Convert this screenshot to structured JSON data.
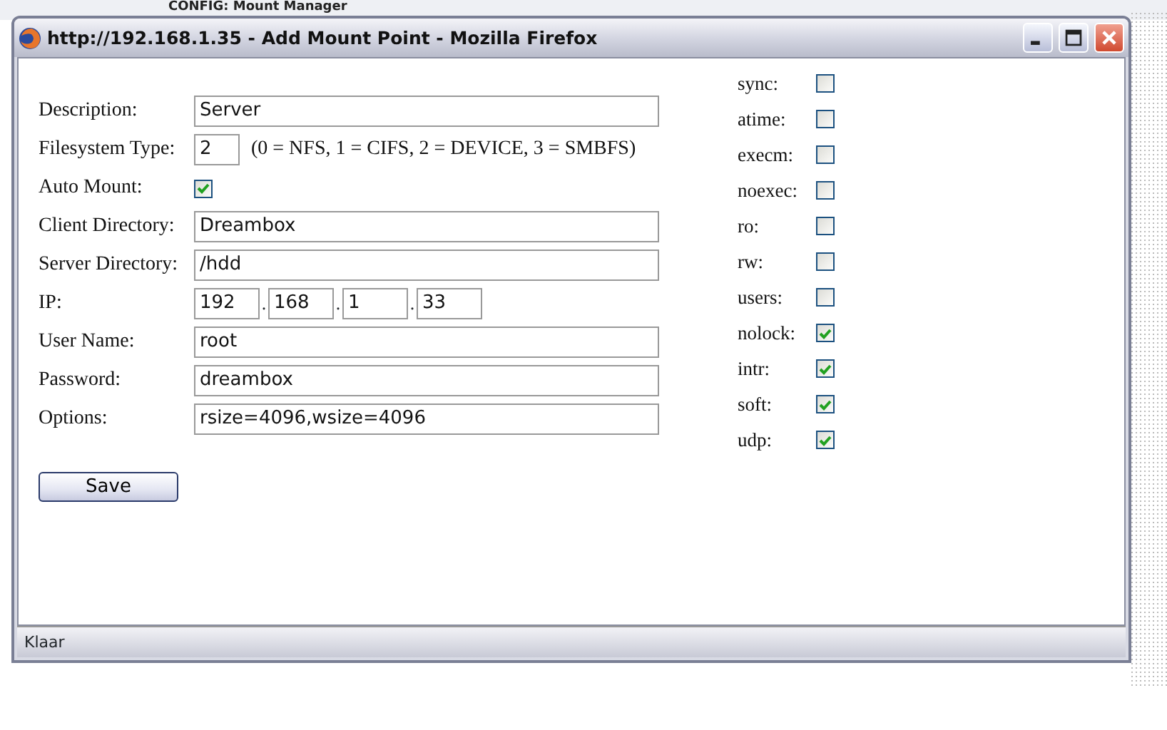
{
  "background_title": "CONFIG: Mount Manager",
  "window": {
    "title": "http://192.168.1.35 - Add Mount Point - Mozilla Firefox"
  },
  "fields": [
    {
      "kind": "text",
      "label": "Description:",
      "value": "Server"
    },
    {
      "kind": "short",
      "label": "Filesystem Type:",
      "value": "2",
      "note": "(0 = NFS, 1 = CIFS, 2 = DEVICE, 3 = SMBFS)"
    },
    {
      "kind": "checkbox",
      "label": "Auto Mount:",
      "checked": true
    },
    {
      "kind": "text",
      "label": "Client Directory:",
      "value": "Dreambox"
    },
    {
      "kind": "text",
      "label": "Server Directory:",
      "value": "/hdd"
    },
    {
      "kind": "ip",
      "label": "IP:",
      "octets": [
        "192",
        "168",
        "1",
        "33"
      ],
      "separators": [
        ".",
        ".",
        "."
      ]
    },
    {
      "kind": "text",
      "label": "User Name:",
      "value": "root"
    },
    {
      "kind": "text",
      "label": "Password:",
      "value": "dreambox"
    },
    {
      "kind": "text",
      "label": "Options:",
      "value": "rsize=4096,wsize=4096"
    }
  ],
  "options": [
    {
      "label": "sync:",
      "checked": false
    },
    {
      "label": "atime:",
      "checked": false
    },
    {
      "label": "execm:",
      "checked": false
    },
    {
      "label": "noexec:",
      "checked": false
    },
    {
      "label": "ro:",
      "checked": false
    },
    {
      "label": "rw:",
      "checked": false
    },
    {
      "label": "users:",
      "checked": false
    },
    {
      "label": "nolock:",
      "checked": true
    },
    {
      "label": "intr:",
      "checked": true
    },
    {
      "label": "soft:",
      "checked": true
    },
    {
      "label": "udp:",
      "checked": true
    }
  ],
  "save_button": "Save",
  "status_bar": "Klaar"
}
